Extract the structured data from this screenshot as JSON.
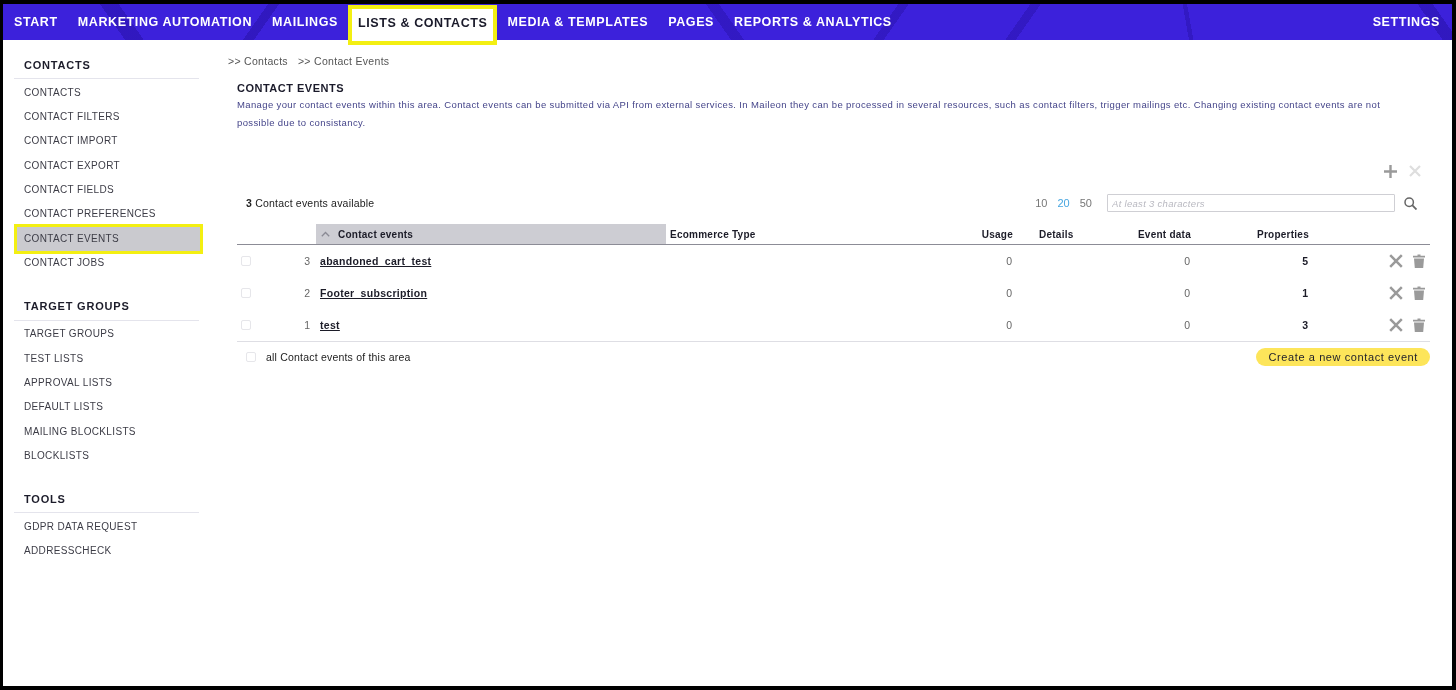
{
  "nav": {
    "tabs": [
      {
        "label": "START",
        "selected": false
      },
      {
        "label": "MARKETING AUTOMATION",
        "selected": false
      },
      {
        "label": "MAILINGS",
        "selected": false
      },
      {
        "label": "LISTS & CONTACTS",
        "selected": true
      },
      {
        "label": "MEDIA & TEMPLATES",
        "selected": false
      },
      {
        "label": "PAGES",
        "selected": false
      },
      {
        "label": "REPORTS & ANALYTICS",
        "selected": false
      }
    ],
    "settings": "SETTINGS"
  },
  "sidebar": {
    "sections": [
      {
        "heading": "CONTACTS",
        "items": [
          {
            "label": "CONTACTS",
            "selected": false
          },
          {
            "label": "CONTACT FILTERS",
            "selected": false
          },
          {
            "label": "CONTACT IMPORT",
            "selected": false
          },
          {
            "label": "CONTACT EXPORT",
            "selected": false
          },
          {
            "label": "CONTACT FIELDS",
            "selected": false
          },
          {
            "label": "CONTACT PREFERENCES",
            "selected": false
          },
          {
            "label": "CONTACT EVENTS",
            "selected": true
          },
          {
            "label": "CONTACT JOBS",
            "selected": false
          }
        ]
      },
      {
        "heading": "TARGET GROUPS",
        "items": [
          {
            "label": "TARGET GROUPS",
            "selected": false
          },
          {
            "label": "TEST LISTS",
            "selected": false
          },
          {
            "label": "APPROVAL LISTS",
            "selected": false
          },
          {
            "label": "DEFAULT LISTS",
            "selected": false
          },
          {
            "label": "MAILING BLOCKLISTS",
            "selected": false
          },
          {
            "label": "BLOCKLISTS",
            "selected": false
          }
        ]
      },
      {
        "heading": "TOOLS",
        "items": [
          {
            "label": "GDPR DATA REQUEST",
            "selected": false
          },
          {
            "label": "ADDRESSCHECK",
            "selected": false
          }
        ]
      }
    ]
  },
  "breadcrumb": [
    ">> Contacts",
    ">> Contact Events"
  ],
  "title": "CONTACT EVENTS",
  "description": "Manage your contact events within this area. Contact events can be submitted via API from external services. In Maileon they can be processed in several resources, such as contact filters, trigger mailings etc. Changing existing contact events are not possible due to consistancy.",
  "toolbar": [
    {
      "kind": "add",
      "disabled": false
    },
    {
      "kind": "remove",
      "disabled": true
    }
  ],
  "summary": "**3** Contact events available",
  "page_sizes": [
    {
      "label": "10",
      "selected": false
    },
    {
      "label": "20",
      "selected": true
    },
    {
      "label": "50",
      "selected": false
    }
  ],
  "search": {
    "placeholder": "At least 3 characters"
  },
  "table": {
    "columns": [
      {
        "label": "Contact events",
        "sorted": true
      },
      {
        "label": "Ecommerce Type",
        "sorted": false
      },
      {
        "label": "Usage",
        "sorted": false
      },
      {
        "label": "Details",
        "sorted": false
      },
      {
        "label": "Event data",
        "sorted": false
      },
      {
        "label": "Properties",
        "sorted": false
      }
    ],
    "rows": [
      {
        "checked": false,
        "number": "3",
        "name": "abandoned_cart_test",
        "usage": "0",
        "event_data": "0",
        "properties": "5"
      },
      {
        "checked": false,
        "number": "2",
        "name": "Footer_subscription",
        "usage": "0",
        "event_data": "0",
        "properties": "1"
      },
      {
        "checked": false,
        "number": "1",
        "name": "test",
        "usage": "0",
        "event_data": "0",
        "properties": "3"
      }
    ],
    "select_all": {
      "checked": false,
      "label": "all Contact events of this area"
    }
  },
  "create_button": "Create a new contact event"
}
